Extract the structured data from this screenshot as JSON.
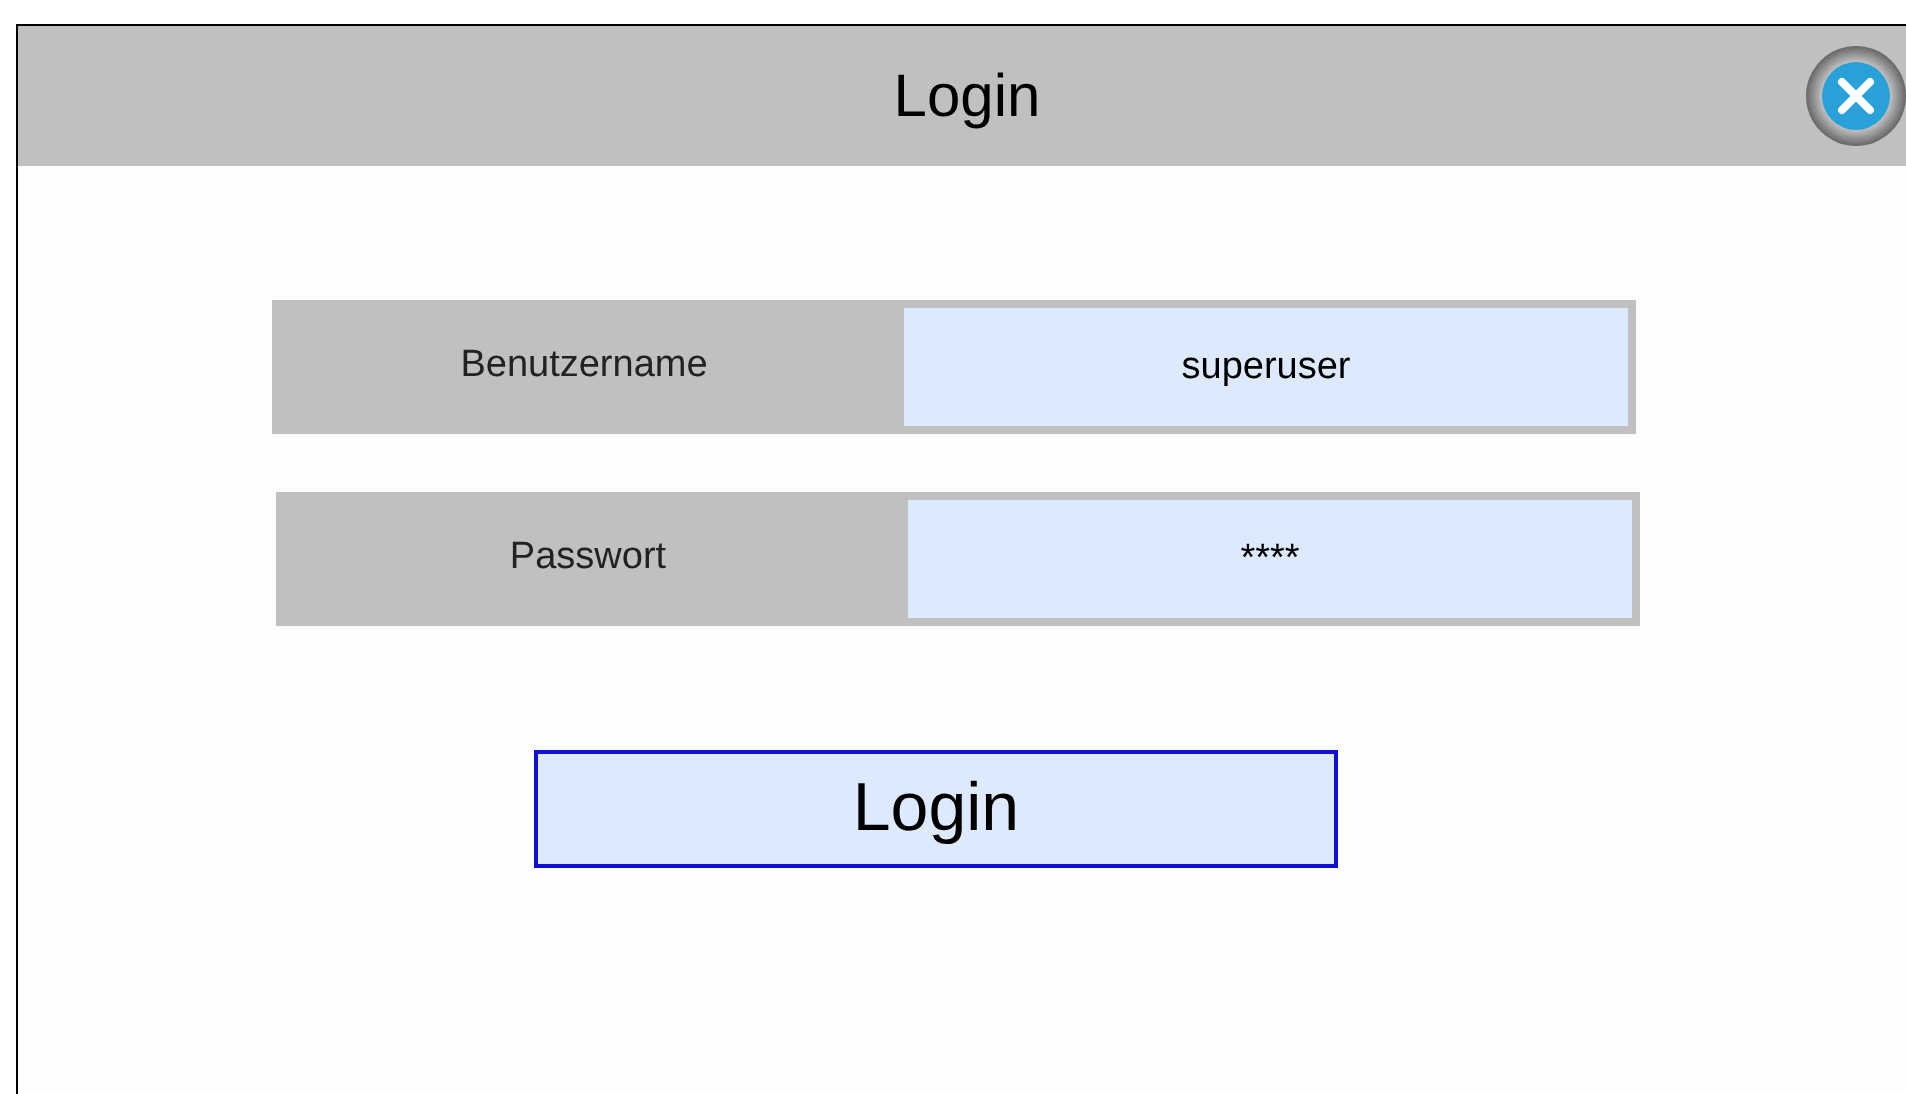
{
  "window": {
    "title": "Login"
  },
  "fields": [
    {
      "label": "Benutzername",
      "value": "superuser"
    },
    {
      "label": "Passwort",
      "value": "****"
    }
  ],
  "login_button": "Login"
}
